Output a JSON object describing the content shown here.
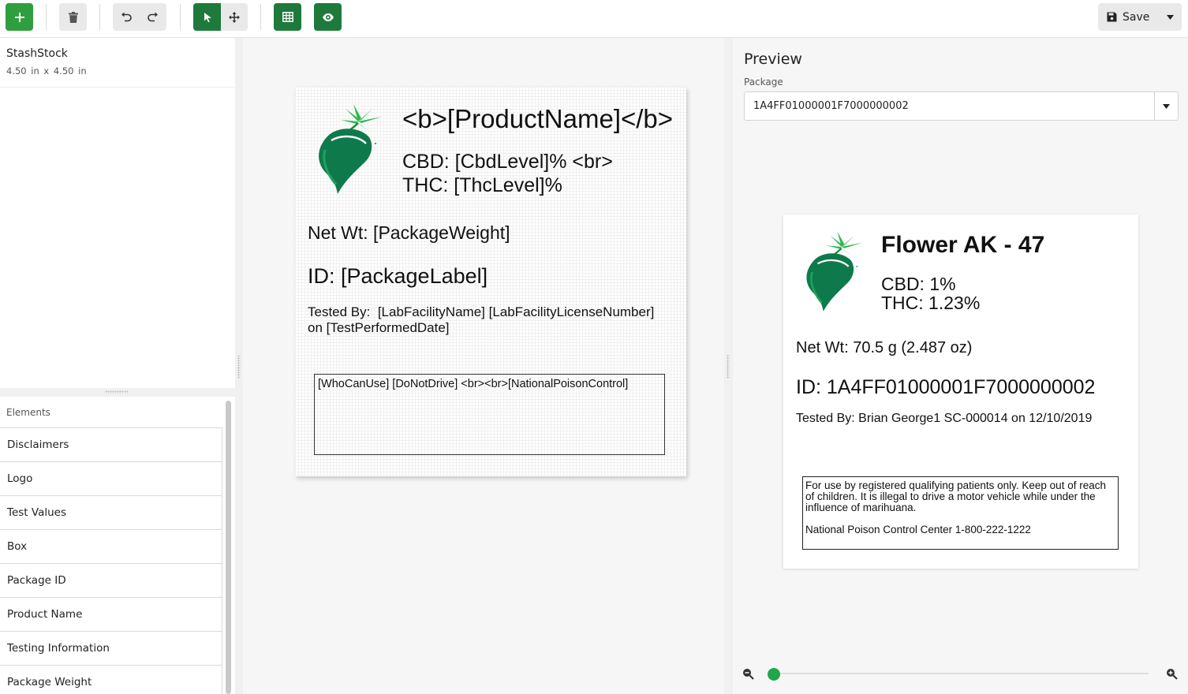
{
  "toolbar": {
    "save_label": "Save"
  },
  "stock": {
    "name": "StashStock",
    "dimensions": "4.50 in  x  4.50 in"
  },
  "elements": {
    "label": "Elements",
    "items": [
      {
        "label": "Disclaimers"
      },
      {
        "label": "Logo"
      },
      {
        "label": "Test Values"
      },
      {
        "label": "Box"
      },
      {
        "label": "Package ID"
      },
      {
        "label": "Product Name"
      },
      {
        "label": "Testing Information"
      },
      {
        "label": "Package Weight"
      }
    ]
  },
  "canvas": {
    "product_name": "<b>[ProductName]</b>",
    "cbd": "CBD: [CbdLevel]% <br>",
    "thc": "THC: [ThcLevel]%",
    "net_wt": "Net Wt: [PackageWeight]",
    "id": "ID: [PackageLabel]",
    "tested_line1": "Tested By:  [LabFacilityName] [LabFacilityLicenseNumber]",
    "tested_line2": "on [TestPerformedDate]",
    "box_text": "[WhoCanUse] [DoNotDrive] <br><br>[NationalPoisonControl]"
  },
  "preview": {
    "title": "Preview",
    "package_label": "Package",
    "package_value": "1A4FF01000001F7000000002",
    "zoom": 0.0,
    "label": {
      "product_name": "Flower AK - 47",
      "cbd": "CBD: 1%",
      "thc": "THC: 1.23%",
      "net_wt": "Net Wt: 70.5 g (2.487 oz)",
      "id": "ID: 1A4FF01000001F7000000002",
      "tested": "Tested By: Brian George1 SC-000014 on 12/10/2019",
      "disclaimer": "For use by registered qualifying patients only. Keep out of reach of children. It is illegal to drive a motor vehicle while under the influence of marihuana.",
      "poison": "National Poison Control Center 1-800-222-1222"
    }
  },
  "colors": {
    "accent_green": "#2f9e3f",
    "dark_green": "#1d7a3a",
    "logo_green": "#0e7a4c"
  }
}
